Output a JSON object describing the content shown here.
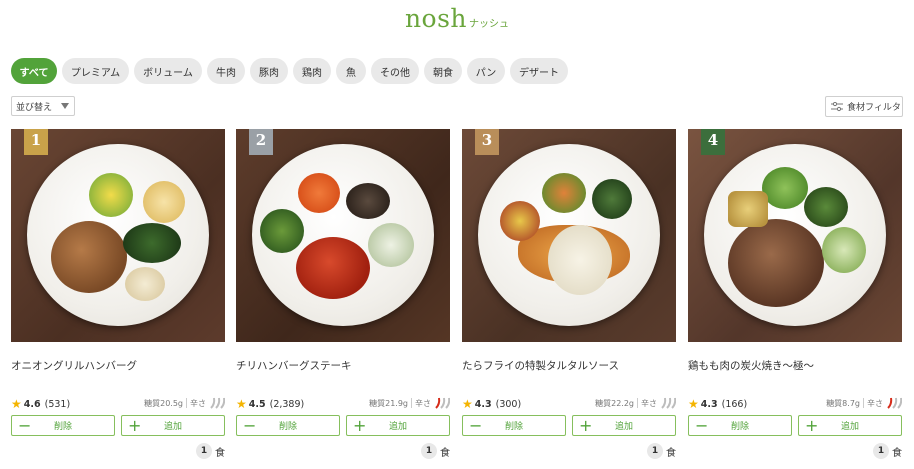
{
  "header": {
    "logo": "nosh",
    "logo_sub": "ナッシュ"
  },
  "tabs": [
    {
      "label": "すべて",
      "active": true
    },
    {
      "label": "プレミアム"
    },
    {
      "label": "ボリューム"
    },
    {
      "label": "牛肉"
    },
    {
      "label": "豚肉"
    },
    {
      "label": "鶏肉"
    },
    {
      "label": "魚"
    },
    {
      "label": "その他"
    },
    {
      "label": "朝食"
    },
    {
      "label": "パン"
    },
    {
      "label": "デザート"
    }
  ],
  "toolbar": {
    "sort_label": "並び替え",
    "filter_label": "食材フィルタ"
  },
  "common": {
    "delete_label": "削除",
    "add_label": "追加",
    "unit": "食",
    "spicy_label": "辛さ"
  },
  "products": [
    {
      "rank": "1",
      "rank_color": "#c9a24a",
      "name": "オニオングリルハンバーグ",
      "rating": "4.6",
      "reviews": "(531)",
      "sugar": "糖質20.5g",
      "spicy_level": 0,
      "qty": "1"
    },
    {
      "rank": "2",
      "rank_color": "#9aa0a6",
      "name": "チリハンバーグステーキ",
      "rating": "4.5",
      "reviews": "(2,389)",
      "sugar": "糖質21.9g",
      "spicy_level": 1,
      "qty": "1"
    },
    {
      "rank": "3",
      "rank_color": "#b98e5a",
      "name": "たらフライの特製タルタルソース",
      "rating": "4.3",
      "reviews": "(300)",
      "sugar": "糖質22.2g",
      "spicy_level": 0,
      "qty": "1"
    },
    {
      "rank": "4",
      "rank_color": "#3c6e3c",
      "name": "鶏もも肉の炭火焼き〜極〜",
      "rating": "4.3",
      "reviews": "(166)",
      "sugar": "糖質8.7g",
      "spicy_level": 1,
      "qty": "1"
    }
  ],
  "colors": {
    "accent": "#52a33a",
    "border": "#86bf5d",
    "chili_on": "#d62c1a",
    "chili_off": "#bdbdbd"
  }
}
